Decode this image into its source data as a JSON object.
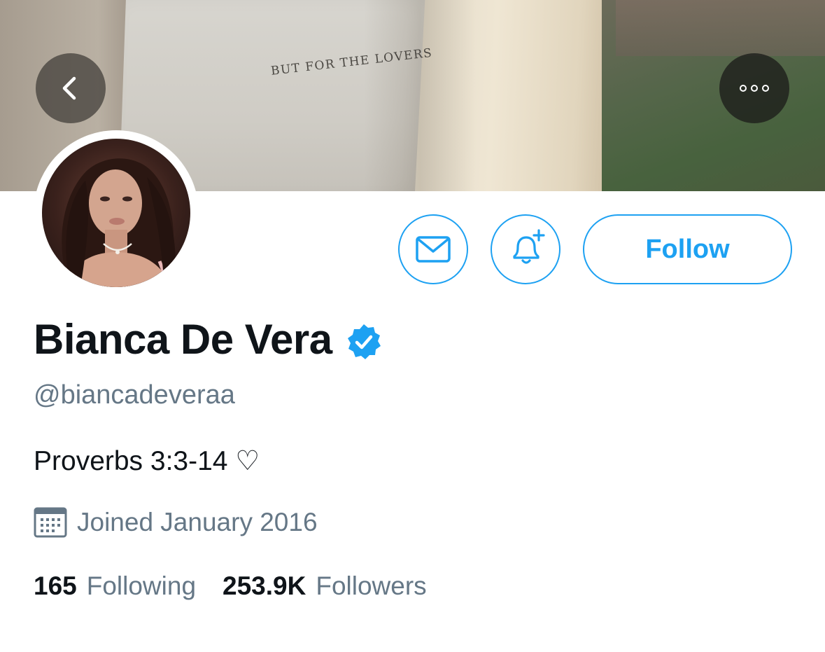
{
  "banner": {
    "text": "BUT FOR THE LOVERS"
  },
  "nav": {
    "back_icon": "chevron-left-icon",
    "more_icon": "more-dots-icon"
  },
  "actions": {
    "message_icon": "envelope-icon",
    "notify_icon": "bell-plus-icon",
    "follow_label": "Follow"
  },
  "profile": {
    "name": "Bianca De Vera",
    "verified": true,
    "handle": "@biancadeveraa",
    "bio": "Proverbs 3:3-14 ♡",
    "joined": "Joined January 2016",
    "following_count": "165",
    "following_label": "Following",
    "followers_count": "253.9K",
    "followers_label": "Followers"
  },
  "colors": {
    "accent": "#1da1f2",
    "secondary_text": "#657786",
    "primary_text": "#0f1419"
  }
}
